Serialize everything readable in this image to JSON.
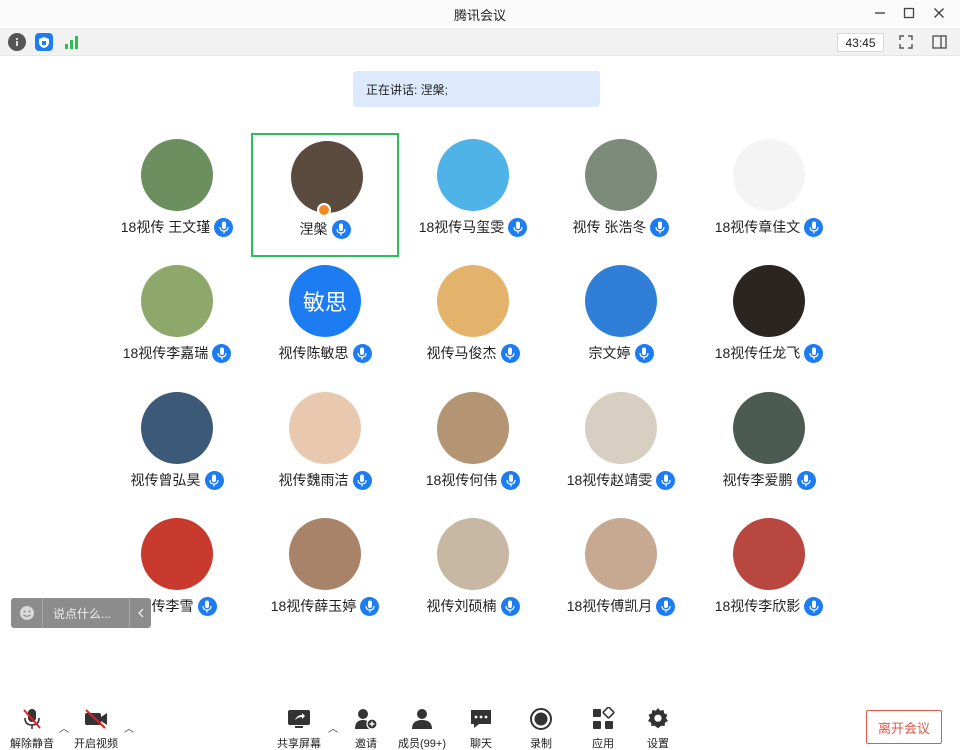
{
  "window": {
    "title": "腾讯会议",
    "minimize_icon": "minimize-icon",
    "maximize_icon": "maximize-icon",
    "close_icon": "close-icon"
  },
  "topbar": {
    "info_icon": "info-icon",
    "shield_icon": "shield-icon",
    "signal_icon": "signal-bars-icon",
    "timer": "43:45",
    "fullscreen_icon": "fullscreen-icon",
    "layout_icon": "sidebar-layout-icon"
  },
  "speaker": {
    "text": "正在讲话: 涅槃;"
  },
  "participants": [
    {
      "name": "18视传 王文瑾",
      "avatar_color": "#6b8f5e",
      "avatar_text": ""
    },
    {
      "name": "涅槃",
      "avatar_color": "#5b4b3f",
      "avatar_text": "",
      "active": true
    },
    {
      "name": "18视传马玺雯",
      "avatar_color": "#4fb3e8",
      "avatar_text": ""
    },
    {
      "name": "视传 张浩冬",
      "avatar_color": "#7d8c7a",
      "avatar_text": ""
    },
    {
      "name": "18视传章佳文",
      "avatar_color": "#f4f4f4",
      "avatar_text": ""
    },
    {
      "name": "18视传李嘉瑞",
      "avatar_color": "#8ea86c",
      "avatar_text": ""
    },
    {
      "name": "视传陈敏思",
      "avatar_color": "#1d7cf2",
      "avatar_text": "敏思"
    },
    {
      "name": "视传马俊杰",
      "avatar_color": "#e3b36b",
      "avatar_text": ""
    },
    {
      "name": "宗文婷",
      "avatar_color": "#2f7fd8",
      "avatar_text": ""
    },
    {
      "name": "18视传任龙飞",
      "avatar_color": "#2b2521",
      "avatar_text": ""
    },
    {
      "name": "视传曾弘昊",
      "avatar_color": "#3c5a78",
      "avatar_text": ""
    },
    {
      "name": "视传魏雨洁",
      "avatar_color": "#e9c8b0",
      "avatar_text": ""
    },
    {
      "name": "18视传何伟",
      "avatar_color": "#b39473",
      "avatar_text": ""
    },
    {
      "name": "18视传赵靖雯",
      "avatar_color": "#d7cfc1",
      "avatar_text": ""
    },
    {
      "name": "视传李爱鹏",
      "avatar_color": "#4b5a52",
      "avatar_text": ""
    },
    {
      "name": "视传李雪",
      "avatar_color": "#c83a2e",
      "avatar_text": ""
    },
    {
      "name": "18视传薛玉婷",
      "avatar_color": "#a8836a",
      "avatar_text": ""
    },
    {
      "name": "视传刘硕楠",
      "avatar_color": "#c7b7a3",
      "avatar_text": ""
    },
    {
      "name": "18视传傅凯月",
      "avatar_color": "#c7a891",
      "avatar_text": ""
    },
    {
      "name": "18视传李欣影",
      "avatar_color": "#b8483f",
      "avatar_text": ""
    }
  ],
  "chat": {
    "placeholder": "说点什么...",
    "emoji_icon": "emoji-icon",
    "collapse_icon": "chevron-left-icon"
  },
  "bottombar": {
    "unmute_label": "解除静音",
    "video_label": "开启视频",
    "share_label": "共享屏幕",
    "invite_label": "邀请",
    "members_label": "成员(99+)",
    "chat_label": "聊天",
    "record_label": "录制",
    "apps_label": "应用",
    "settings_label": "设置",
    "leave_label": "离开会议"
  },
  "colors": {
    "accent": "#1d7cf2",
    "active_border": "#2ebd59",
    "leave": "#e05a4a",
    "speaker_bg": "#ddeafd"
  }
}
